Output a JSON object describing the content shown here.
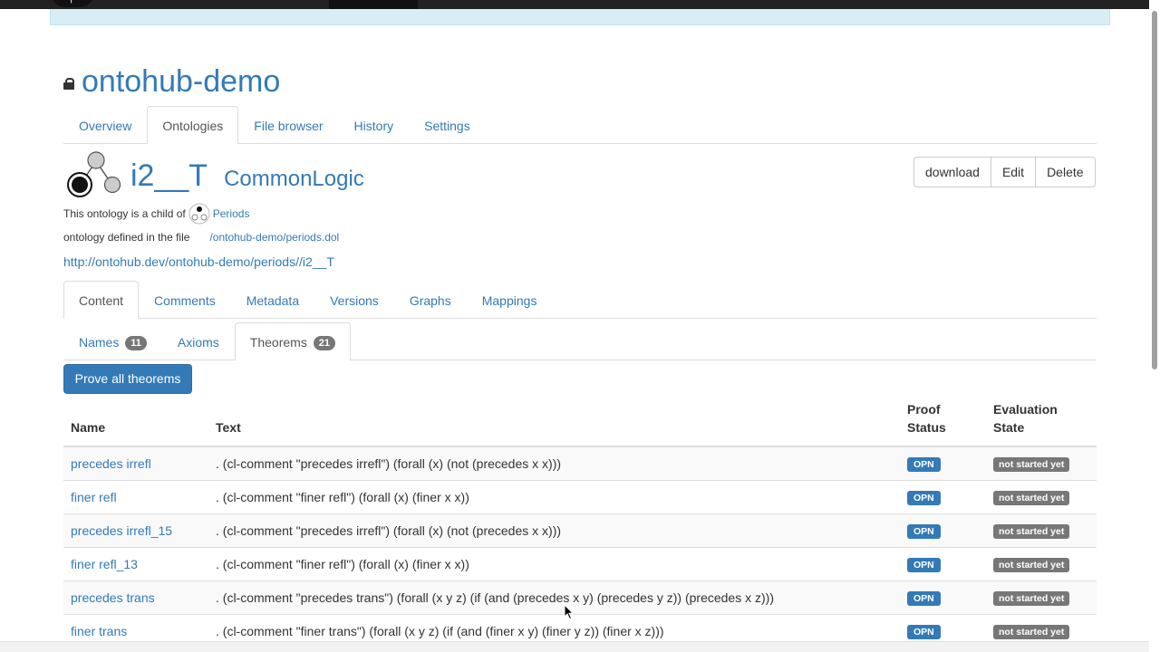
{
  "repository": {
    "name": "ontohub-demo"
  },
  "main_tabs": [
    {
      "label": "Overview",
      "active": false
    },
    {
      "label": "Ontologies",
      "active": true
    },
    {
      "label": "File browser",
      "active": false
    },
    {
      "label": "History",
      "active": false
    },
    {
      "label": "Settings",
      "active": false
    }
  ],
  "ontology": {
    "name": "i2__T",
    "logic": "CommonLogic",
    "child_of_text": "This ontology is a child of",
    "parent_name": "Periods",
    "file_text": "ontology defined in the file",
    "file_path": "/ontohub-demo/periods.dol",
    "iri": "http://ontohub.dev/ontohub-demo/periods//i2__T"
  },
  "actions": {
    "download": "download",
    "edit": "Edit",
    "delete": "Delete"
  },
  "content_tabs": [
    {
      "label": "Content",
      "active": true
    },
    {
      "label": "Comments",
      "active": false
    },
    {
      "label": "Metadata",
      "active": false
    },
    {
      "label": "Versions",
      "active": false
    },
    {
      "label": "Graphs",
      "active": false
    },
    {
      "label": "Mappings",
      "active": false
    }
  ],
  "sub_tabs": {
    "names": {
      "label": "Names",
      "count": "11"
    },
    "axioms": {
      "label": "Axioms"
    },
    "theorems": {
      "label": "Theorems",
      "count": "21"
    }
  },
  "prove_button": "Prove all theorems",
  "table": {
    "headers": {
      "name": "Name",
      "text": "Text",
      "proof_line1": "Proof",
      "proof_line2": "Status",
      "eval_line1": "Evaluation",
      "eval_line2": "State"
    },
    "rows": [
      {
        "name": "precedes irrefl",
        "text": ". (cl-comment \"precedes irrefl\") (forall (x) (not (precedes x x)))",
        "proof": "OPN",
        "eval": "not started yet"
      },
      {
        "name": "finer refl",
        "text": ". (cl-comment \"finer refl\") (forall (x) (finer x x))",
        "proof": "OPN",
        "eval": "not started yet"
      },
      {
        "name": "precedes irrefl_15",
        "text": ". (cl-comment \"precedes irrefl\") (forall (x) (not (precedes x x)))",
        "proof": "OPN",
        "eval": "not started yet"
      },
      {
        "name": "finer refl_13",
        "text": ". (cl-comment \"finer refl\") (forall (x) (finer x x))",
        "proof": "OPN",
        "eval": "not started yet"
      },
      {
        "name": "precedes trans",
        "text": ". (cl-comment \"precedes trans\") (forall (x y z) (if (and (precedes x y) (precedes y z)) (precedes x z)))",
        "proof": "OPN",
        "eval": "not started yet"
      },
      {
        "name": "finer trans",
        "text": ". (cl-comment \"finer trans\") (forall (x y z) (if (and (finer x y) (finer y z)) (finer x z)))",
        "proof": "OPN",
        "eval": "not started yet"
      }
    ]
  }
}
